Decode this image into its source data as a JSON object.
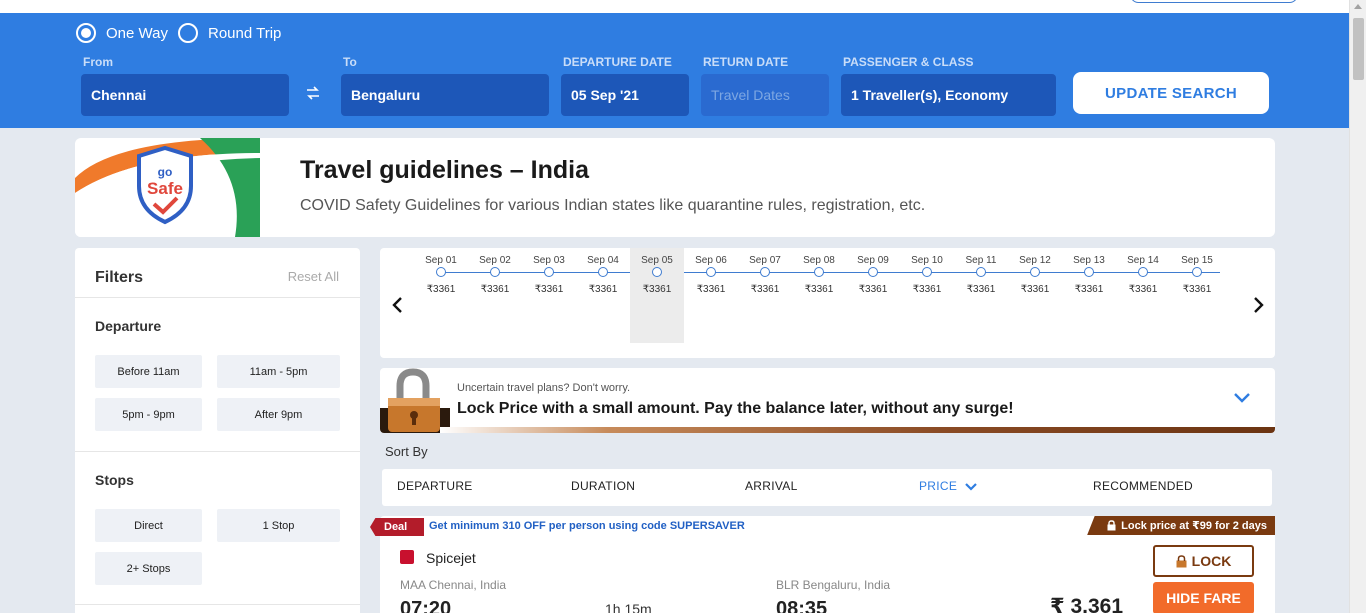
{
  "trip_type": {
    "options": [
      {
        "label": "One Way",
        "selected": true
      },
      {
        "label": "Round Trip",
        "selected": false
      }
    ]
  },
  "search": {
    "from_label": "From",
    "from_value": "Chennai",
    "to_label": "To",
    "to_value": "Bengaluru",
    "departure_label": "DEPARTURE DATE",
    "departure_value": "05 Sep '21",
    "return_label": "RETURN DATE",
    "return_placeholder": "Travel Dates",
    "passenger_label": "PASSENGER & CLASS",
    "passenger_value": "1 Traveller(s), Economy",
    "update_button": "UPDATE SEARCH",
    "swap_icon": "swap-arrows-icon"
  },
  "guidelines": {
    "logo_text_top": "go",
    "logo_text_main": "Safe",
    "title": "Travel guidelines – India",
    "subtitle": "COVID Safety Guidelines for various Indian states like quarantine rules, registration, etc."
  },
  "filters": {
    "title": "Filters",
    "reset": "Reset All",
    "departure_title": "Departure",
    "departure_options": [
      "Before 11am",
      "11am - 5pm",
      "5pm - 9pm",
      "After 9pm"
    ],
    "stops_title": "Stops",
    "stops_options": [
      "Direct",
      "1 Stop",
      "2+ Stops"
    ]
  },
  "date_strip": {
    "selected_index": 4,
    "days": [
      {
        "date": "Sep 01",
        "price": "₹3361"
      },
      {
        "date": "Sep 02",
        "price": "₹3361"
      },
      {
        "date": "Sep 03",
        "price": "₹3361"
      },
      {
        "date": "Sep 04",
        "price": "₹3361"
      },
      {
        "date": "Sep 05",
        "price": "₹3361"
      },
      {
        "date": "Sep 06",
        "price": "₹3361"
      },
      {
        "date": "Sep 07",
        "price": "₹3361"
      },
      {
        "date": "Sep 08",
        "price": "₹3361"
      },
      {
        "date": "Sep 09",
        "price": "₹3361"
      },
      {
        "date": "Sep 10",
        "price": "₹3361"
      },
      {
        "date": "Sep 11",
        "price": "₹3361"
      },
      {
        "date": "Sep 12",
        "price": "₹3361"
      },
      {
        "date": "Sep 13",
        "price": "₹3361"
      },
      {
        "date": "Sep 14",
        "price": "₹3361"
      },
      {
        "date": "Sep 15",
        "price": "₹3361"
      }
    ],
    "prev_icon": "chevron-left-icon",
    "next_icon": "chevron-right-icon"
  },
  "lock_banner": {
    "small": "Uncertain travel plans? Don't worry.",
    "big": "Lock Price with a small amount. Pay the balance later, without any surge!",
    "expand_icon": "chevron-down-icon"
  },
  "sort": {
    "label": "Sort By",
    "options": [
      "DEPARTURE",
      "DURATION",
      "ARRIVAL",
      "PRICE",
      "RECOMMENDED"
    ],
    "active": "PRICE"
  },
  "flight": {
    "deal_tag": "Deal",
    "deal_text": "Get minimum 310 OFF per person using code SUPERSAVER",
    "lock_price_tag": "Lock price at ₹99 for 2 days",
    "airline": "Spicejet",
    "from": "MAA Chennai, India",
    "to": "BLR Bengaluru, India",
    "departure_time": "07:20",
    "arrival_time": "08:35",
    "duration": "1h 15m",
    "price": "₹ 3,361",
    "lock_button": "LOCK",
    "hide_button": "HIDE FARE"
  },
  "colors": {
    "brand_blue": "#2f7de1",
    "field_blue": "#1d57b8",
    "deal_red": "#b31c2a",
    "lock_brown": "#7a3a10",
    "hide_orange": "#f26b2a"
  }
}
